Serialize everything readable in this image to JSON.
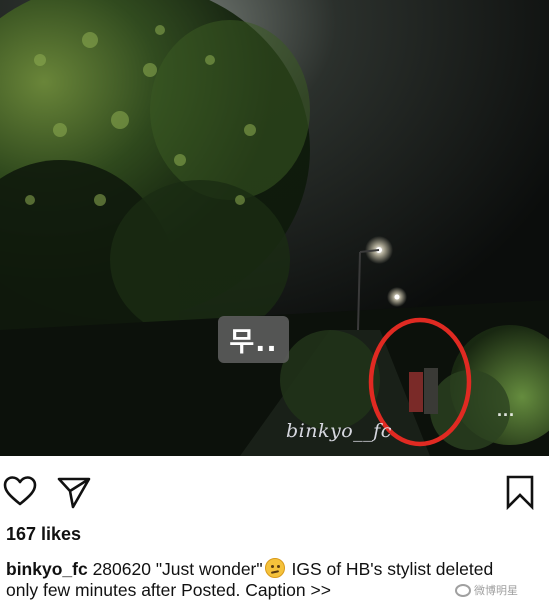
{
  "photo": {
    "sticker_text": "무..",
    "watermark": "binkyo__fc",
    "more_dots": "..."
  },
  "post": {
    "likes": "167 likes",
    "username": "binkyo_fc",
    "caption_part1": " 280620 \"Just wonder\"",
    "caption_part2": " IGS of HB's stylist deleted only few minutes after Posted. Caption ",
    "more": ">>"
  },
  "icons": {
    "like": "heart-icon",
    "share": "paper-plane-icon",
    "save": "bookmark-icon",
    "emoji": "thinking-face-emoji"
  },
  "overlay": {
    "weibo_watermark": "微博明星"
  },
  "colors": {
    "highlight_circle": "#e02a22",
    "text": "#111111",
    "background": "#ffffff"
  }
}
